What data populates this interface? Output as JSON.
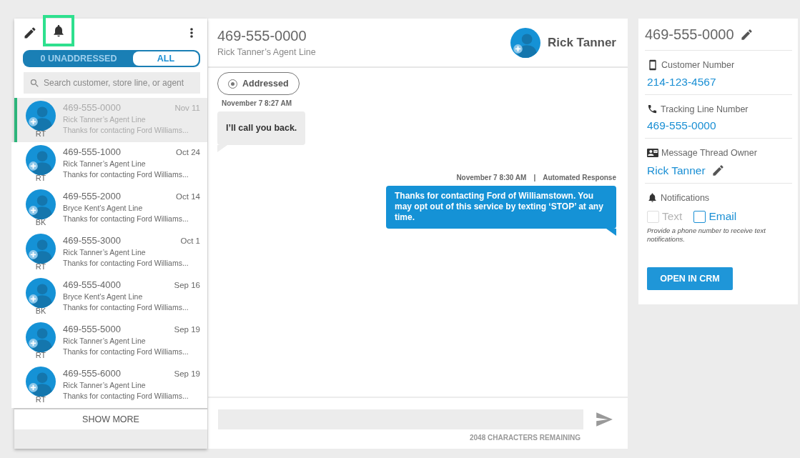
{
  "left": {
    "toolbar": {
      "bell_highlighted": true
    },
    "filter_tabs": [
      {
        "label": "0 UNADDRESSED",
        "selected": false
      },
      {
        "label": "ALL",
        "selected": true
      }
    ],
    "search": {
      "placeholder": "Search customer, store line, or agent"
    },
    "conversations": [
      {
        "number": "469-555-0000",
        "date": "Nov 11",
        "line": "Rick Tanner’s Agent Line",
        "preview": "Thanks for contacting Ford Williams...",
        "initials": "RT",
        "selected": true
      },
      {
        "number": "469-555-1000",
        "date": "Oct 24",
        "line": "Rick Tanner’s Agent Line",
        "preview": "Thanks for contacting Ford Williams...",
        "initials": "RT",
        "selected": false
      },
      {
        "number": "469-555-2000",
        "date": "Oct 14",
        "line": "Bryce Kent’s Agent Line",
        "preview": "Thanks for contacting Ford Williams...",
        "initials": "BK",
        "selected": false
      },
      {
        "number": "469-555-3000",
        "date": "Oct 1",
        "line": "Rick Tanner’s Agent Line",
        "preview": "Thanks for contacting Ford Williams...",
        "initials": "RT",
        "selected": false
      },
      {
        "number": "469-555-4000",
        "date": "Sep 16",
        "line": "Bryce Kent’s Agent Line",
        "preview": "Thanks for contacting Ford Williams...",
        "initials": "BK",
        "selected": false
      },
      {
        "number": "469-555-5000",
        "date": "Sep 19",
        "line": "Rick Tanner’s Agent Line",
        "preview": "Thanks for contacting Ford Williams...",
        "initials": "RT",
        "selected": false
      },
      {
        "number": "469-555-6000",
        "date": "Sep 19",
        "line": "Rick Tanner’s Agent Line",
        "preview": "Thanks for contacting Ford Williams...",
        "initials": "RT",
        "selected": false
      }
    ],
    "show_more": "SHOW MORE"
  },
  "thread": {
    "header": {
      "number": "469-555-0000",
      "line": "Rick Tanner’s Agent Line",
      "owner": "Rick Tanner"
    },
    "status_button": "Addressed",
    "messages": [
      {
        "kind": "incoming",
        "time": "November 7 8:27 AM",
        "text": "I’ll call you back."
      },
      {
        "kind": "outgoing",
        "time": "November 7 8:30 AM",
        "separator": "|",
        "tag": "Automated Response",
        "text": "Thanks for contacting Ford of Williamstown. You may opt out of this service by texting ‘STOP’ at any time."
      }
    ],
    "composer": {
      "remaining": "2048 CHARACTERS REMAINING"
    }
  },
  "details": {
    "title": "469-555-0000",
    "sections": [
      {
        "kind": "phone",
        "label": "Customer Number",
        "value": "214-123-4567"
      },
      {
        "kind": "call",
        "label": "Tracking Line Number",
        "value": "469-555-0000"
      },
      {
        "kind": "owner",
        "label": "Message Thread Owner",
        "value": "Rick Tanner"
      }
    ],
    "notifications": {
      "label": "Notifications",
      "options": [
        {
          "label": "Text",
          "checked": false,
          "disabled": true
        },
        {
          "label": "Email",
          "checked": false,
          "disabled": false
        }
      ],
      "hint": "Provide a phone number to receive text notifications."
    },
    "crm_button": "OPEN IN CRM"
  }
}
